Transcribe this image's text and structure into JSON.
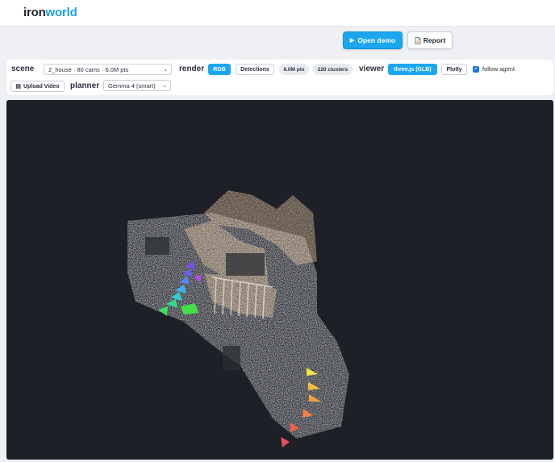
{
  "app": {
    "logo_part1": "iron",
    "logo_part2": "world"
  },
  "actions": {
    "open_demo_label": "Open demo",
    "open_demo_icon": "play-icon",
    "report_label": "Report",
    "report_icon": "document-icon"
  },
  "toolbar": {
    "scene_label": "scene",
    "scene_value": "2_house · 80 cams · 6.0M pts",
    "render_label": "render",
    "render_options": [
      "RGB",
      "Detections"
    ],
    "render_selected": "RGB",
    "stat_points": "6.0M pts",
    "stat_clusters": "220 clusters",
    "viewer_label": "viewer",
    "viewer_options": [
      "three.js (GLB)",
      "Plotly"
    ],
    "viewer_selected": "three.js (GLB)",
    "follow_agent_label": "follow agent",
    "follow_agent_checked": true,
    "upload_video_label": "Upload Video",
    "upload_icon": "film-icon",
    "planner_label": "planner",
    "planner_value": "Gemma 4 (smart)"
  },
  "colors": {
    "accent": "#1ba7ef",
    "viewer_bg": "#1d2027",
    "checkbox": "#1b73e8"
  }
}
